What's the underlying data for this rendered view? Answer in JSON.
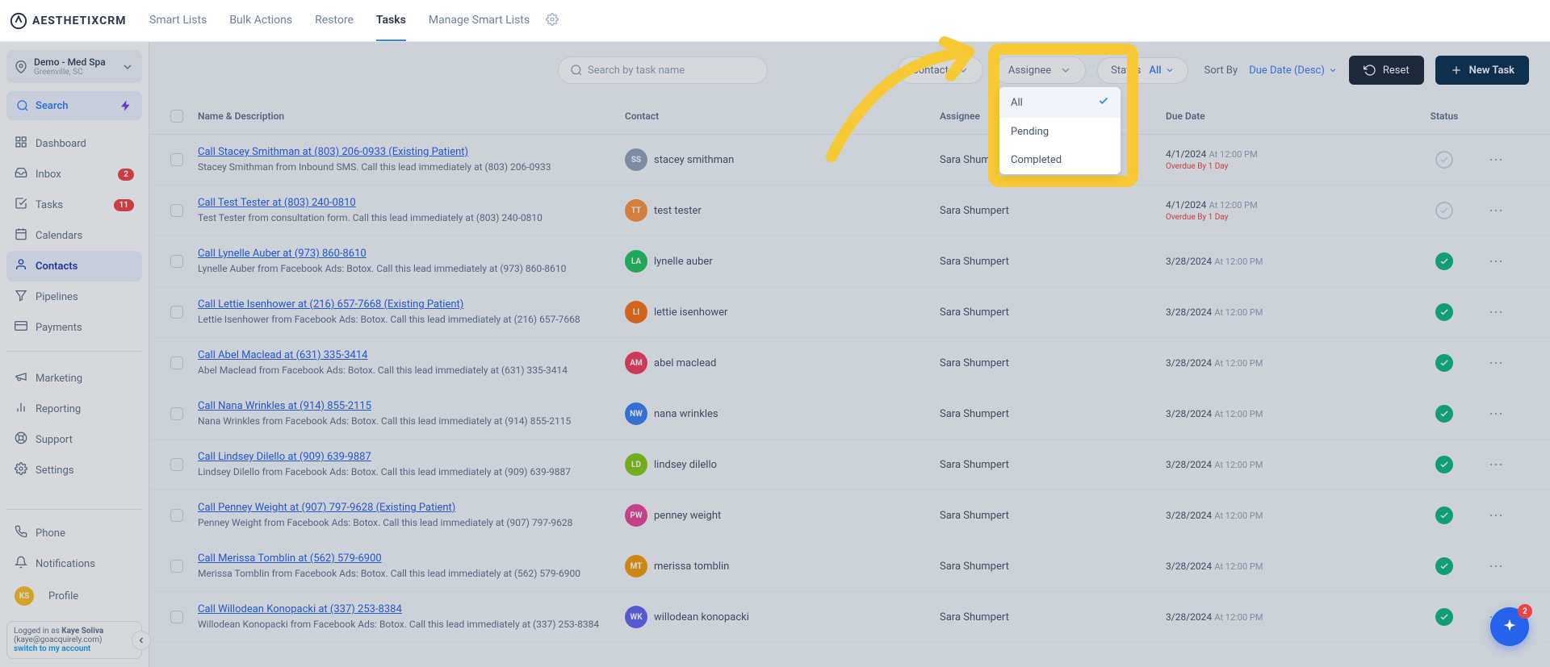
{
  "brand": "AESTHETIXCRM",
  "topnav": [
    "Smart Lists",
    "Bulk Actions",
    "Restore",
    "Tasks",
    "Manage Smart Lists"
  ],
  "topnav_active": 3,
  "location": {
    "name": "Demo - Med Spa",
    "sub": "Greenville, SC"
  },
  "search_label": "Search",
  "sidenav": [
    {
      "label": "Dashboard",
      "icon": "grid"
    },
    {
      "label": "Inbox",
      "icon": "inbox",
      "badge": "2"
    },
    {
      "label": "Tasks",
      "icon": "check",
      "badge": "11"
    },
    {
      "label": "Calendars",
      "icon": "calendar"
    },
    {
      "label": "Contacts",
      "icon": "user",
      "active": true
    },
    {
      "label": "Pipelines",
      "icon": "funnel"
    },
    {
      "label": "Payments",
      "icon": "card"
    }
  ],
  "sidenav2": [
    {
      "label": "Marketing",
      "icon": "megaphone"
    },
    {
      "label": "Reporting",
      "icon": "chart"
    },
    {
      "label": "Support",
      "icon": "life"
    },
    {
      "label": "Settings",
      "icon": "gear"
    }
  ],
  "sidenav3": [
    {
      "label": "Phone",
      "icon": "phone"
    },
    {
      "label": "Notifications",
      "icon": "bell"
    },
    {
      "label": "Profile",
      "icon": "avatar",
      "avatar": "KS"
    }
  ],
  "impersonate": {
    "prefix": "Logged in as ",
    "name": "Kaye Soliva",
    "email": "(kaye@goacquirely.com)",
    "switch": "switch to my account"
  },
  "toolbar": {
    "search_placeholder": "Search by task name",
    "contact_label": "Contact",
    "assignee_label": "Assignee",
    "status_label": "Status",
    "status_value": "All",
    "sort_label": "Sort By",
    "sort_value": "Due Date (Desc)",
    "reset": "Reset",
    "new": "New Task"
  },
  "status_options": [
    "All",
    "Pending",
    "Completed"
  ],
  "columns": {
    "name": "Name & Description",
    "contact": "Contact",
    "assignee": "Assignee",
    "due": "Due Date",
    "status": "Status"
  },
  "rows": [
    {
      "title": "Call Stacey Smithman at (803) 206-0933 (Existing Patient)",
      "desc": "Stacey Smithman from Inbound SMS. Call this lead immediately at (803) 206-0933",
      "contact": "stacey smithman",
      "cini": "SS",
      "ccol": "#94a3b8",
      "assignee": "Sara Shumpert",
      "date": "4/1/2024",
      "time": "At 12:00 PM",
      "overdue": "Overdue By 1 Day",
      "status": "pending"
    },
    {
      "title": "Call Test Tester at (803) 240-0810",
      "desc": "Test Tester from consultation form. Call this lead immediately at (803) 240-0810",
      "contact": "test tester",
      "cini": "TT",
      "ccol": "#fb923c",
      "assignee": "Sara Shumpert",
      "date": "4/1/2024",
      "time": "At 12:00 PM",
      "overdue": "Overdue By 1 Day",
      "status": "pending"
    },
    {
      "title": "Call Lynelle Auber at (973) 860-8610",
      "desc": "Lynelle Auber from Facebook Ads: Botox. Call this lead immediately at (973) 860-8610",
      "contact": "lynelle auber",
      "cini": "LA",
      "ccol": "#22c55e",
      "assignee": "Sara Shumpert",
      "date": "3/28/2024",
      "time": "At 12:00 PM",
      "status": "done"
    },
    {
      "title": "Call Lettie Isenhower at (216) 657-7668 (Existing Patient)",
      "desc": "Lettie Isenhower from Facebook Ads: Botox. Call this lead immediately at (216) 657-7668",
      "contact": "lettie isenhower",
      "cini": "LI",
      "ccol": "#f97316",
      "assignee": "Sara Shumpert",
      "date": "3/28/2024",
      "time": "At 12:00 PM",
      "status": "done"
    },
    {
      "title": "Call Abel Maclead at (631) 335-3414",
      "desc": "Abel Maclead from Facebook Ads: Botox. Call this lead immediately at (631) 335-3414",
      "contact": "abel maclead",
      "cini": "AM",
      "ccol": "#f43f5e",
      "assignee": "Sara Shumpert",
      "date": "3/28/2024",
      "time": "At 12:00 PM",
      "status": "done"
    },
    {
      "title": "Call Nana Wrinkles at (914) 855-2115",
      "desc": "Nana Wrinkles from Facebook Ads: Botox. Call this lead immediately at (914) 855-2115",
      "contact": "nana wrinkles",
      "cini": "NW",
      "ccol": "#3b82f6",
      "assignee": "Sara Shumpert",
      "date": "3/28/2024",
      "time": "At 12:00 PM",
      "status": "done"
    },
    {
      "title": "Call Lindsey Dilello at (909) 639-9887",
      "desc": "Lindsey Dilello from Facebook Ads: Botox. Call this lead immediately at (909) 639-9887",
      "contact": "lindsey dilello",
      "cini": "LD",
      "ccol": "#84cc16",
      "assignee": "Sara Shumpert",
      "date": "3/28/2024",
      "time": "At 12:00 PM",
      "status": "done"
    },
    {
      "title": "Call Penney Weight at (907) 797-9628 (Existing Patient)",
      "desc": "Penney Weight from Facebook Ads: Botox. Call this lead immediately at (907) 797-9628",
      "contact": "penney weight",
      "cini": "PW",
      "ccol": "#ec4899",
      "assignee": "Sara Shumpert",
      "date": "3/28/2024",
      "time": "At 12:00 PM",
      "status": "done"
    },
    {
      "title": "Call Merissa Tomblin at (562) 579-6900",
      "desc": "Merissa Tomblin from Facebook Ads: Botox. Call this lead immediately at (562) 579-6900",
      "contact": "merissa tomblin",
      "cini": "MT",
      "ccol": "#f59e0b",
      "assignee": "Sara Shumpert",
      "date": "3/28/2024",
      "time": "At 12:00 PM",
      "status": "done"
    },
    {
      "title": "Call Willodean Konopacki at (337) 253-8384",
      "desc": "Willodean Konopacki from Facebook Ads: Botox. Call this lead immediately at (337) 253-8384",
      "contact": "willodean konopacki",
      "cini": "WK",
      "ccol": "#6366f1",
      "assignee": "Sara Shumpert",
      "date": "3/28/2024",
      "time": "At 12:00 PM",
      "status": "done"
    }
  ],
  "fab_badge": "2"
}
